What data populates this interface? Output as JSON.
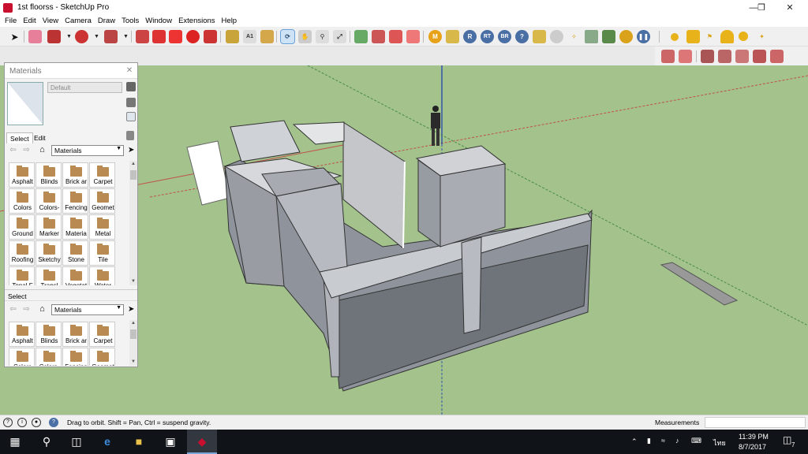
{
  "window": {
    "title": "1st floorss - SketchUp Pro",
    "controls": [
      "minimize-icon",
      "restore-icon",
      "close-icon"
    ]
  },
  "menu": [
    "File",
    "Edit",
    "View",
    "Camera",
    "Draw",
    "Tools",
    "Window",
    "Extensions",
    "Help"
  ],
  "materials_tray": {
    "title": "Materials",
    "material_name_placeholder": "Default",
    "tabs": [
      "Select",
      "Edit"
    ],
    "library_dropdown": "Materials",
    "materials": [
      "Asphalt",
      "Blinds",
      "Brick ar",
      "Carpet",
      "Colors",
      "Colors-",
      "Fencing",
      "Geomet",
      "Ground",
      "Marker",
      "Materia",
      "Metal",
      "Roofing",
      "Sketchy",
      "Stone",
      "Tile",
      "Tonal F",
      "Transl",
      "Vegetat",
      "Water"
    ],
    "secondary_label": "Select",
    "secondary_dropdown": "Materials",
    "secondary_materials": [
      "Asphalt",
      "Blinds",
      "Brick ar",
      "Carpet",
      "Colors",
      "Colors-",
      "Fencing",
      "Geomet"
    ]
  },
  "toolbar": {
    "active_tool": "orbit-icon",
    "accent_color": "#c8102e"
  },
  "statusbar": {
    "message": "Drag to orbit. Shift = Pan, Ctrl = suspend gravity.",
    "measurements_label": "Measurements",
    "measurements_value": ""
  },
  "taskbar": {
    "input_lang": "ไทย",
    "time": "11:39 PM",
    "date": "8/7/2017",
    "notifications": "7"
  }
}
